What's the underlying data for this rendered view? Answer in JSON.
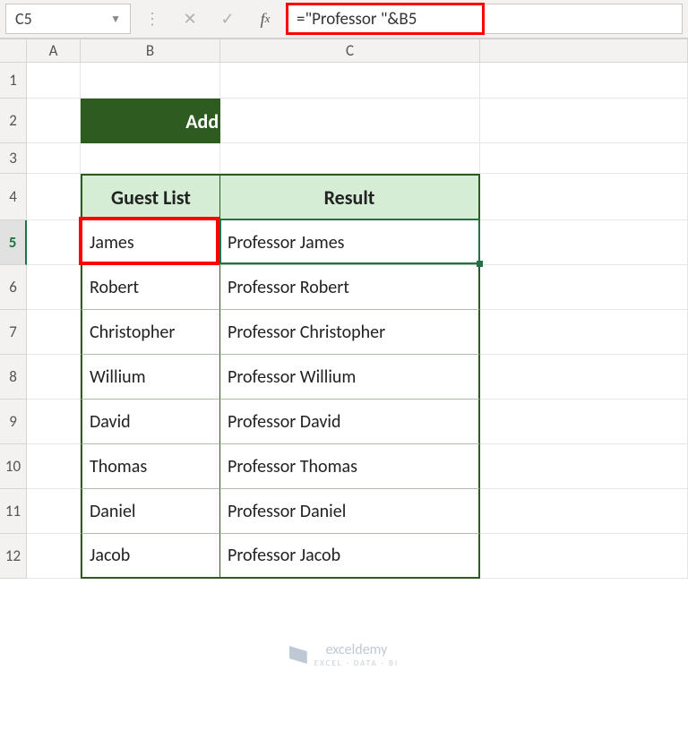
{
  "formula_bar": {
    "cell_ref": "C5",
    "formula": "=\"Professor \"&B5"
  },
  "columns": {
    "A": "A",
    "B": "B",
    "C": "C"
  },
  "title": "Add Characters in Excel",
  "headers": {
    "guest": "Guest List",
    "result": "Result"
  },
  "rows": [
    {
      "n": "1"
    },
    {
      "n": "2"
    },
    {
      "n": "3"
    },
    {
      "n": "4"
    },
    {
      "n": "5",
      "guest": "James",
      "result": "Professor James"
    },
    {
      "n": "6",
      "guest": "Robert",
      "result": "Professor Robert"
    },
    {
      "n": "7",
      "guest": "Christopher",
      "result": "Professor Christopher"
    },
    {
      "n": "8",
      "guest": "Willium",
      "result": "Professor Willium"
    },
    {
      "n": "9",
      "guest": "David",
      "result": "Professor David"
    },
    {
      "n": "10",
      "guest": "Thomas",
      "result": "Professor Thomas"
    },
    {
      "n": "11",
      "guest": "Daniel",
      "result": "Professor Daniel"
    },
    {
      "n": "12",
      "guest": "Jacob",
      "result": "Professor Jacob"
    }
  ],
  "watermark": {
    "brand": "exceldemy",
    "tagline": "EXCEL · DATA · BI"
  }
}
